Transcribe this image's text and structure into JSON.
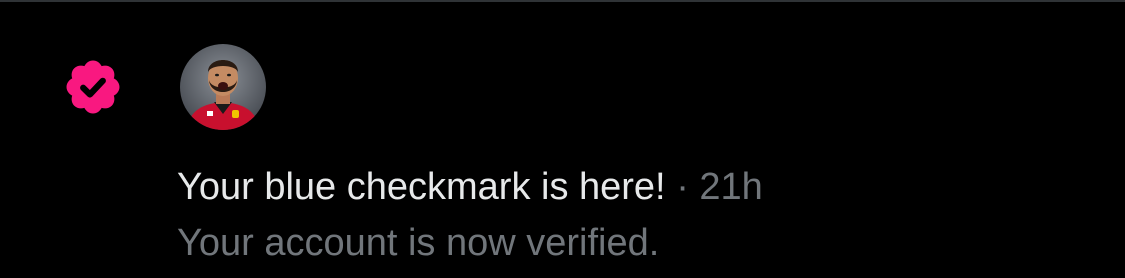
{
  "notification": {
    "icon": "verified-badge-icon",
    "badge_color": "#f91880",
    "avatar": "user-avatar",
    "title": "Your blue checkmark is here!",
    "separator": "·",
    "timestamp": "21h",
    "body": "Your account is now verified."
  },
  "colors": {
    "background": "#000000",
    "primary_text": "#e7e9ea",
    "secondary_text": "#71767b"
  }
}
